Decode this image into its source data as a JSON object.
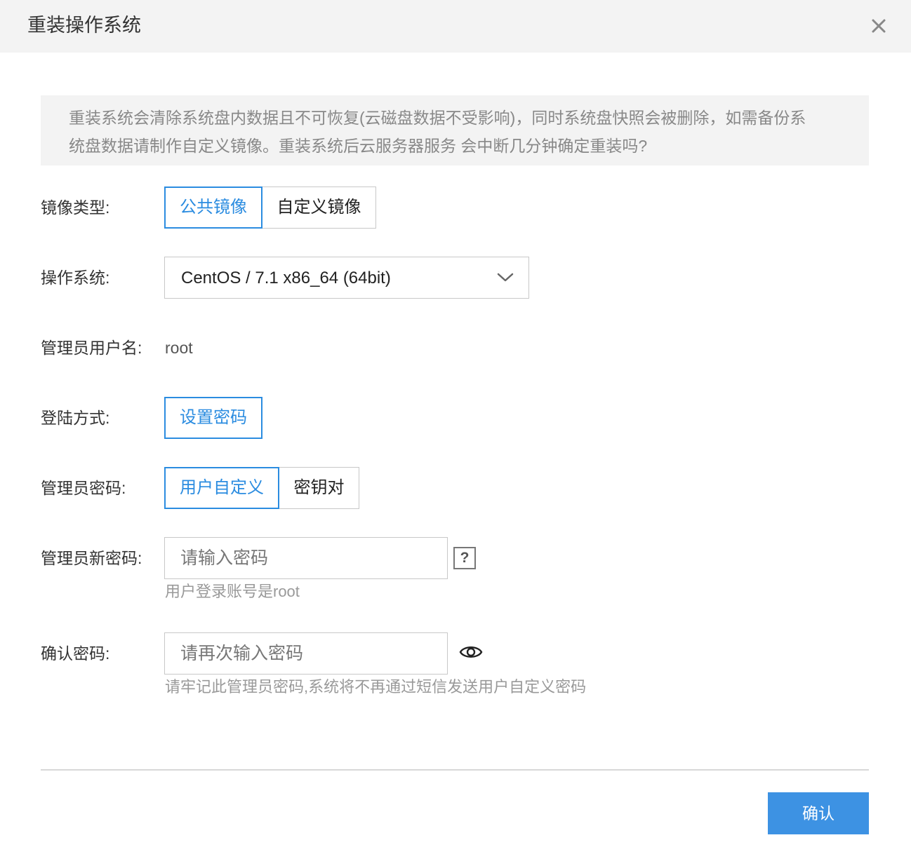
{
  "dialog": {
    "title": "重装操作系统"
  },
  "notice": {
    "line1": "重装系统会清除系统盘内数据且不可恢复(云磁盘数据不受影响)，同时系统盘快照会被删除，如需备份系",
    "line2": "统盘数据请制作自定义镜像。重装系统后云服务器服务 会中断几分钟确定重装吗?"
  },
  "image_type": {
    "label": "镜像类型:",
    "options": [
      "公共镜像",
      "自定义镜像"
    ],
    "selected": "公共镜像"
  },
  "os": {
    "label": "操作系统:",
    "value": "CentOS / 7.1 x86_64 (64bit)"
  },
  "admin_user": {
    "label": "管理员用户名:",
    "value": "root"
  },
  "login_method": {
    "label": "登陆方式:",
    "option": "设置密码"
  },
  "admin_password": {
    "label": "管理员密码:",
    "options": [
      "用户自定义",
      "密钥对"
    ],
    "selected": "用户自定义"
  },
  "new_password": {
    "label": "管理员新密码:",
    "placeholder": "请输入密码",
    "help_glyph": "?",
    "hint": "用户登录账号是root"
  },
  "confirm_password": {
    "label": "确认密码:",
    "placeholder": "请再次输入密码",
    "hint": "请牢记此管理员密码,系统将不再通过短信发送用户自定义密码"
  },
  "footer": {
    "confirm_label": "确认"
  },
  "icons": {
    "close": "close-icon",
    "chevron": "chevron-down-icon",
    "help": "help-icon",
    "eye": "eye-icon"
  },
  "colors": {
    "accent": "#2b8ce0",
    "primary_button": "#3d92e3",
    "header_bg": "#f3f3f3",
    "hint_text": "#999999"
  }
}
